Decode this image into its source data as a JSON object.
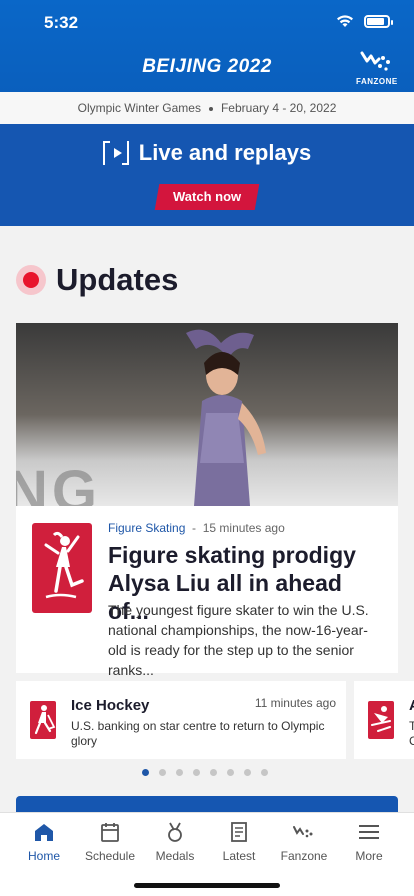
{
  "status_bar": {
    "time": "5:32",
    "battery_level": 0.85
  },
  "header": {
    "brand": "BEIJING 2022",
    "fanzone_label": "FANZONE"
  },
  "subheader": {
    "event": "Olympic Winter Games",
    "dates": "February 4 - 20, 2022"
  },
  "live_banner": {
    "title": "Live and replays",
    "button_label": "Watch now"
  },
  "updates": {
    "title": "Updates"
  },
  "featured": {
    "category": "Figure Skating",
    "separator": "-",
    "time": "15 minutes ago",
    "headline": "Figure skating prodigy Alysa Liu all in ahead of...",
    "summary": "The youngest figure skater to win the U.S. national championships, the now-16-year-old is ready for the step up to the senior ranks...",
    "image_text": "NG CHAMPIC",
    "pictogram": "figure-skating-pictogram"
  },
  "carousel": {
    "cards": [
      {
        "title": "Ice Hockey",
        "time": "11 minutes ago",
        "text": "U.S. banking on star centre to return to Olympic glory",
        "pictogram": "ice-hockey-pictogram"
      },
      {
        "title": "A",
        "text": "T\nC",
        "pictogram": "alpine-skiing-pictogram"
      }
    ],
    "page_count": 8,
    "active_index": 0
  },
  "tabbar": {
    "items": [
      {
        "label": "Home",
        "icon": "home-icon",
        "active": true
      },
      {
        "label": "Schedule",
        "icon": "calendar-icon",
        "active": false
      },
      {
        "label": "Medals",
        "icon": "medal-icon",
        "active": false
      },
      {
        "label": "Latest",
        "icon": "document-icon",
        "active": false
      },
      {
        "label": "Fanzone",
        "icon": "fanzone-icon",
        "active": false
      },
      {
        "label": "More",
        "icon": "menu-icon",
        "active": false
      }
    ]
  },
  "colors": {
    "header_blue": "#0a67c8",
    "banner_blue": "#1556b1",
    "accent_red": "#d3153d",
    "link_blue": "#1f57a8"
  }
}
